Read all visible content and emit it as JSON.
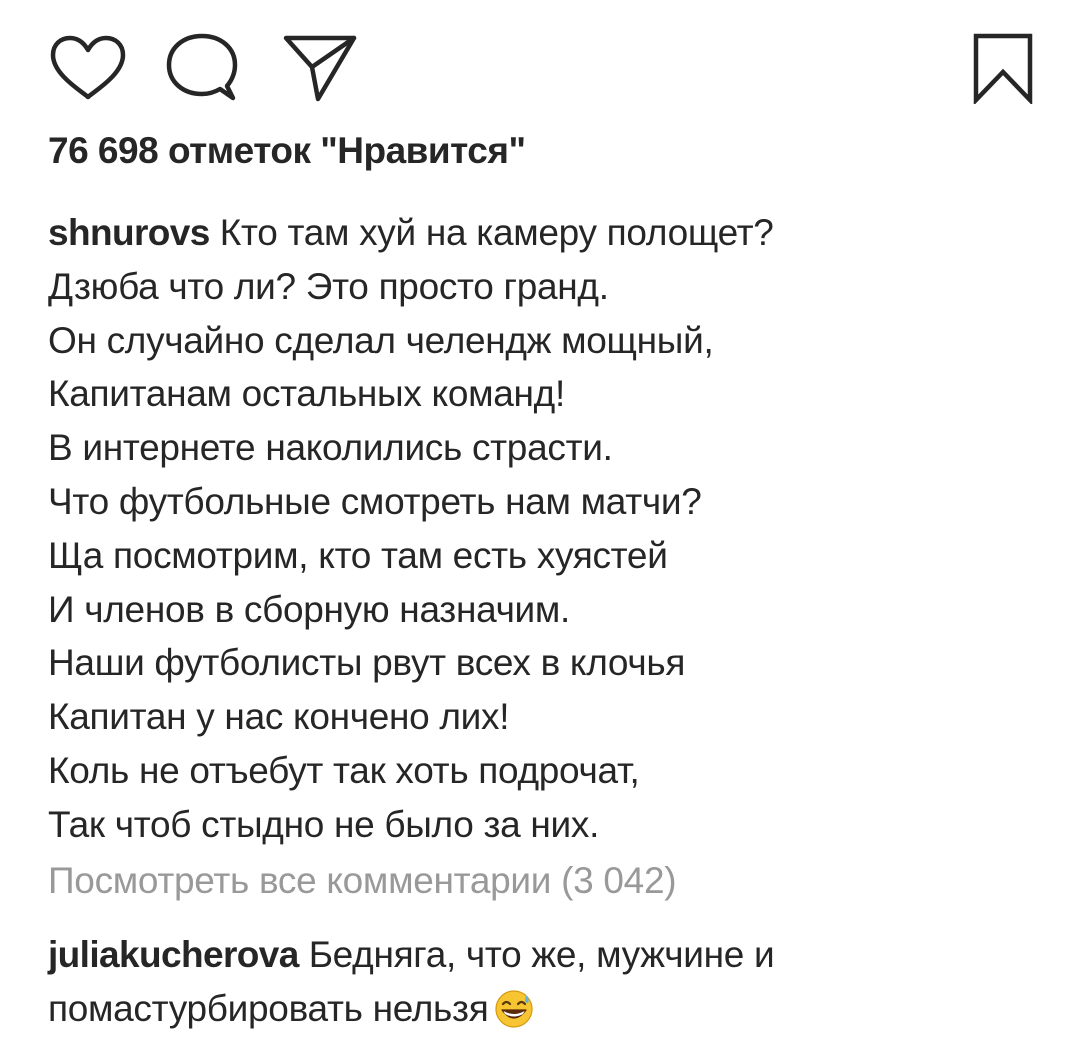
{
  "actions": {
    "like_icon": "heart-outline",
    "comment_icon": "speech-bubble",
    "share_icon": "paper-plane",
    "save_icon": "bookmark-outline"
  },
  "likes": {
    "text": "76 698 отметок \"Нравится\""
  },
  "caption": {
    "username": "shnurovs",
    "lines": [
      "Кто там хуй на камеру полощет?",
      "Дзюба что ли? Это просто гранд.",
      "Он случайно сделал челендж мощный,",
      "Капитанам остальных команд!",
      "В интернете наколились страсти.",
      "Что футбольные смотреть нам матчи?",
      "Ща посмотрим, кто там есть хуястей",
      "И членов в сборную назначим.",
      "Наши футболисты рвут всех в клочья",
      "Капитан у нас кончено лих!",
      "Коль не отъебут так хоть подрочат,",
      "Так чтоб стыдно не было за них."
    ]
  },
  "view_all_comments": "Посмотреть все комментарии (3 042)",
  "comment": {
    "username": "juliakucherova",
    "line1": "Бедняга, что же, мужчине и",
    "line2": "помастурбировать нельзя",
    "emoji": "grinning-face-with-sweat"
  },
  "colors": {
    "text": "#262626",
    "muted": "#999999",
    "emoji_face": "#F7C531"
  }
}
